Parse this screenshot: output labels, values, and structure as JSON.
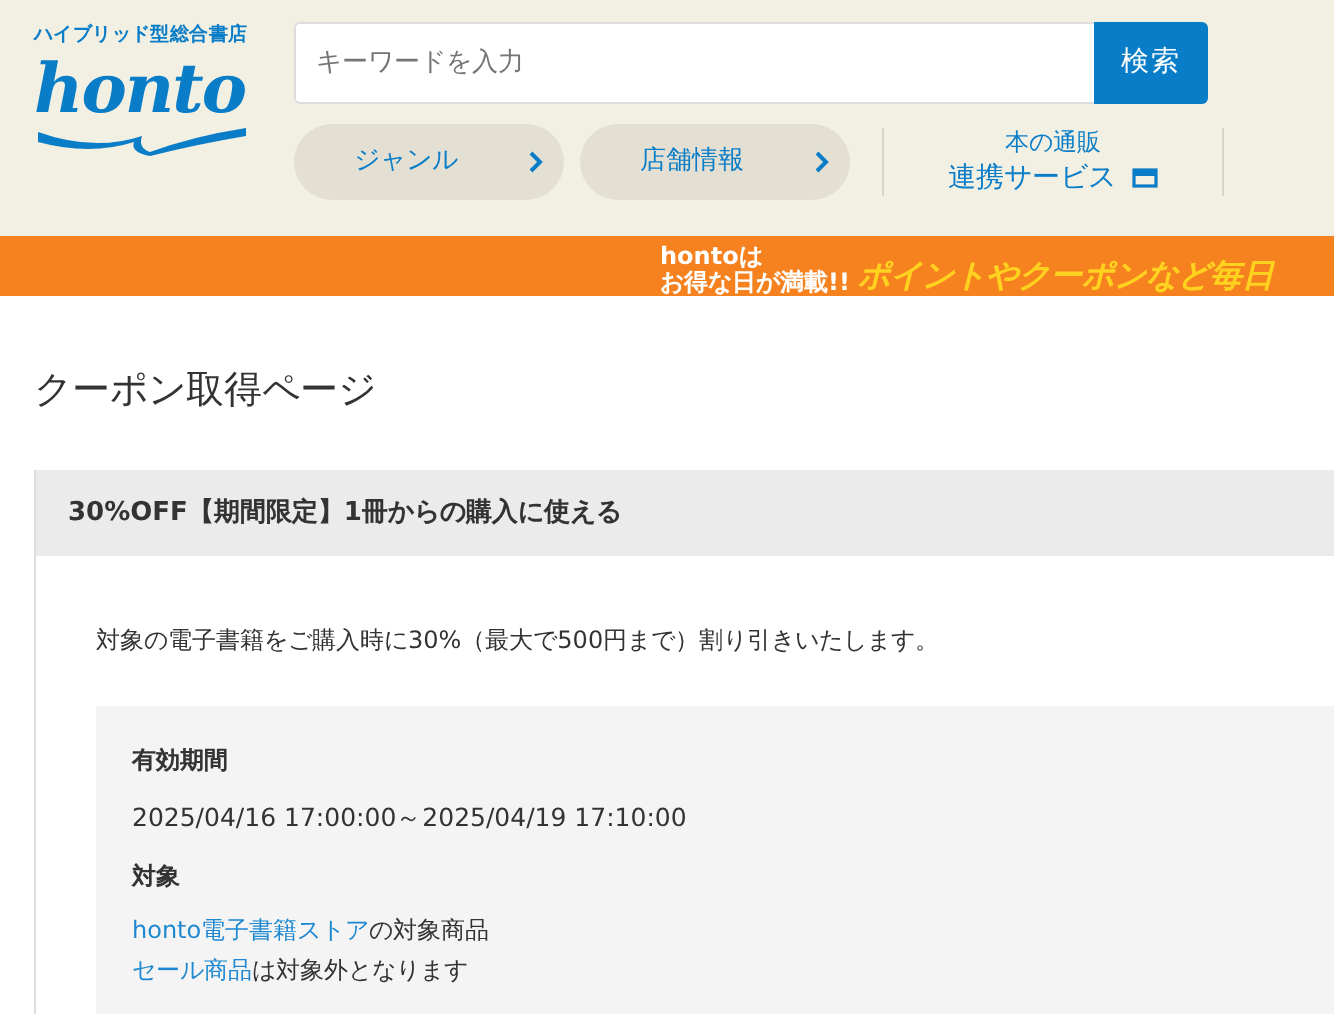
{
  "header": {
    "tagline": "ハイブリッド型総合書店",
    "logo": "honto",
    "search": {
      "placeholder": "キーワードを入力",
      "button": "検索"
    },
    "nav": [
      {
        "label": "ジャンル"
      },
      {
        "label": "店舗情報"
      }
    ],
    "service": {
      "line1": "本の通販",
      "line2": "連携サービス"
    }
  },
  "banner": {
    "line1": "hontoは",
    "line2": "お得な日が満載!!",
    "slogan": "ポイントやクーポンなど毎日"
  },
  "page_title": "クーポン取得ページ",
  "coupon": {
    "title": "30%OFF【期間限定】1冊からの購入に使える",
    "description": "対象の電子書籍をご購入時に30%（最大で500円まで）割り引きいたします。",
    "details": [
      {
        "kind": "heading",
        "text": "有効期間"
      },
      {
        "kind": "text",
        "text": "2025/04/16 17:00:00～2025/04/19 17:10:00"
      },
      {
        "kind": "heading",
        "text": "対象"
      },
      {
        "kind": "linked",
        "link": "honto電子書籍ストア",
        "text": "の対象商品"
      },
      {
        "kind": "linked",
        "link": "セール商品",
        "text": "は対象外となります"
      }
    ]
  }
}
